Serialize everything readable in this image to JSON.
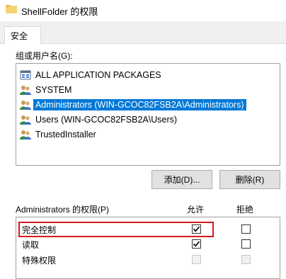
{
  "window": {
    "title": "ShellFolder 的权限",
    "icon": "folder-icon"
  },
  "tabs": [
    {
      "label": "安全"
    }
  ],
  "group_section": {
    "label": "组或用户名(G):",
    "items": [
      {
        "label": "ALL APPLICATION PACKAGES",
        "icon": "packages-icon",
        "selected": false
      },
      {
        "label": "SYSTEM",
        "icon": "users-icon",
        "selected": false
      },
      {
        "label": "Administrators (WIN-GCOC82FSB2A\\Administrators)",
        "icon": "users-icon",
        "selected": true
      },
      {
        "label": "Users (WIN-GCOC82FSB2A\\Users)",
        "icon": "users-icon",
        "selected": false
      },
      {
        "label": "TrustedInstaller",
        "icon": "users-icon",
        "selected": false
      }
    ]
  },
  "buttons": {
    "add": "添加(D)...",
    "remove": "删除(R)"
  },
  "permissions": {
    "header": "Administrators 的权限(P)",
    "allow_header": "允许",
    "deny_header": "拒绝",
    "rows": [
      {
        "label": "完全控制",
        "allow": true,
        "deny": false,
        "enabled": true
      },
      {
        "label": "读取",
        "allow": true,
        "deny": false,
        "enabled": true
      },
      {
        "label": "特殊权限",
        "allow": false,
        "deny": false,
        "enabled": false
      }
    ]
  },
  "colors": {
    "selection": "#0078d7",
    "highlight_border": "#d9161c"
  }
}
